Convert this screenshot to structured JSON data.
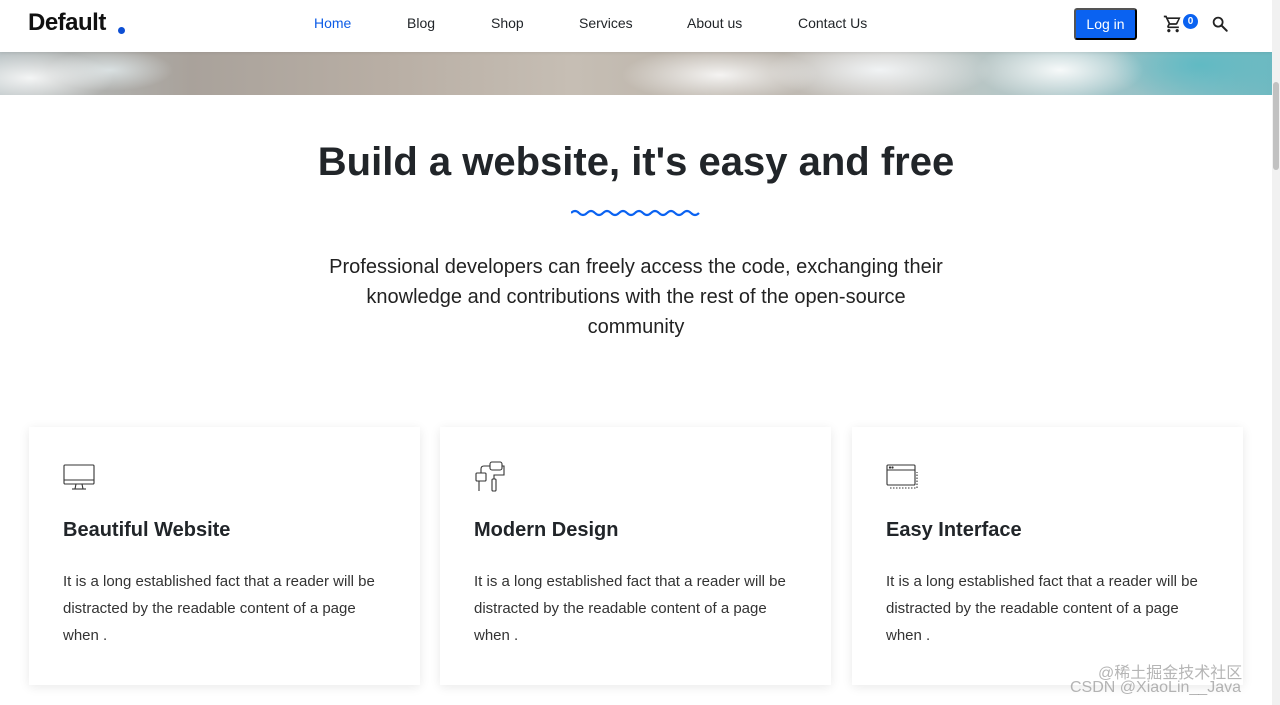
{
  "header": {
    "logo": "Default",
    "nav": [
      {
        "label": "Home",
        "active": true
      },
      {
        "label": "Blog",
        "active": false
      },
      {
        "label": "Shop",
        "active": false
      },
      {
        "label": "Services",
        "active": false
      },
      {
        "label": "About us",
        "active": false
      },
      {
        "label": "Contact Us",
        "active": false
      }
    ],
    "login_label": "Log in",
    "cart_count": "0",
    "icons": [
      "cart-icon",
      "search-icon"
    ]
  },
  "intro": {
    "title": "Build a website, it's easy and free",
    "text": "Professional developers can freely access the code, exchanging their knowledge and contributions with the rest of the open-source community"
  },
  "features": [
    {
      "icon": "monitor-icon",
      "title": "Beautiful Website",
      "text": "It is a long established fact that a reader will be distracted by the readable content of a page when ."
    },
    {
      "icon": "paint-roller-icon",
      "title": "Modern Design",
      "text": "It is a long established fact that a reader will be distracted by the readable content of a page when ."
    },
    {
      "icon": "browser-window-icon",
      "title": "Easy Interface",
      "text": "It is a long established fact that a reader will be distracted by the readable content of a page when ."
    }
  ],
  "watermark": {
    "line1": "@稀土掘金技术社区",
    "line2": "CSDN @XiaoLin__Java"
  },
  "colors": {
    "accent": "#0a62f1",
    "text": "#212529"
  }
}
